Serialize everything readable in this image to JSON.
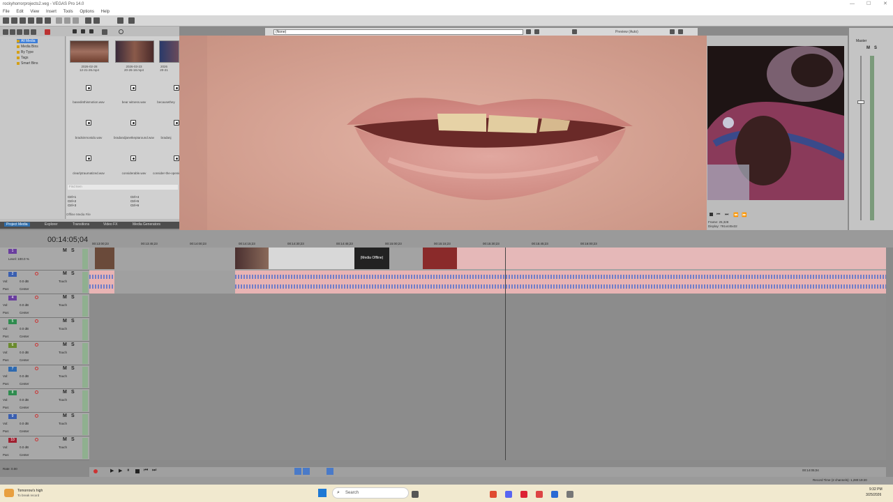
{
  "window": {
    "title": "rockyhorrorprojects2.veg - VEGAS Pro 14.0"
  },
  "menu": [
    "File",
    "Edit",
    "View",
    "Insert",
    "Tools",
    "Options",
    "Help"
  ],
  "explorer": {
    "tree": [
      "All Media",
      "Media Bins",
      "By Type",
      "Tags",
      "Smart Bins"
    ],
    "media": [
      {
        "label": "2026-02-28\n12-21-26.mp4"
      },
      {
        "label": "2026-03-23\n20-26-18.mp4"
      },
      {
        "label": "2026\n20-21"
      },
      {
        "label": "basedinthismotion.wav"
      },
      {
        "label": "bear witness.wav"
      },
      {
        "label": "becausethey"
      },
      {
        "label": "bradsinmostdo.wav"
      },
      {
        "label": "bradandjanetkeptaround.wav"
      },
      {
        "label": "bradanj"
      },
      {
        "label": "clearlytraumatized.wav"
      },
      {
        "label": "considerable.wav"
      },
      {
        "label": "consider-the-opening.wav"
      }
    ],
    "search_placeholder": "Find Item",
    "shortcuts_left": [
      "Ctrl+1",
      "Ctrl+2",
      "Ctrl+3"
    ],
    "shortcuts_right": [
      "Ctrl+4",
      "Ctrl+5",
      "Ctrl+6"
    ],
    "offline": "Offline Media File",
    "tabs": [
      "Project Media",
      "Explorer",
      "Transitions",
      "Video FX",
      "Media Generators"
    ]
  },
  "preview": {
    "dropdown": "(None)",
    "mode": "Preview (Auto)",
    "frame": "Frame:  25,328",
    "display": "Display:  791x445x32"
  },
  "master": {
    "label": "Master"
  },
  "timeline": {
    "timecode": "00:14:05;04",
    "level": "Level: 100.0 %",
    "ruler": [
      "00:13:00;23",
      "00:13:45;23",
      "00:14:00;23",
      "00:14:15;23",
      "00:14:30;23",
      "00:14:45;23",
      "00:15:00;23",
      "00:15:15;23",
      "00:15:30;23",
      "00:15:45;23",
      "00:16:00;23"
    ],
    "tracks": [
      {
        "num": "1",
        "color": "#6a3e9e",
        "type": "video"
      },
      {
        "num": "2",
        "color": "#3a5fb0",
        "type": "audio"
      },
      {
        "num": "4",
        "color": "#6a3e9e",
        "type": "audio"
      },
      {
        "num": "5",
        "color": "#2e8b4e",
        "type": "audio"
      },
      {
        "num": "6",
        "color": "#6a8a2e",
        "type": "audio"
      },
      {
        "num": "7",
        "color": "#2e6ab0",
        "type": "audio"
      },
      {
        "num": "8",
        "color": "#2e8b4e",
        "type": "audio"
      },
      {
        "num": "9",
        "color": "#3a5fb0",
        "type": "audio"
      },
      {
        "num": "10",
        "color": "#a02030",
        "type": "audio"
      }
    ],
    "vol": "Vol:",
    "vol_val": "0.0 dB",
    "pan": "Pan:",
    "pan_val": "Center",
    "touch": "Touch",
    "clip_label": "(Media Offline)"
  },
  "status": {
    "rate": "Rate: 0.00",
    "right": "Record Time (2 channels): 1,280:19:20",
    "tc": "00:14:05;04"
  },
  "taskbar": {
    "weather": "Tomorrow's high",
    "weather_sub": "To break record",
    "search": "Search",
    "time": "9:32 PM",
    "date": "3/25/2026"
  }
}
